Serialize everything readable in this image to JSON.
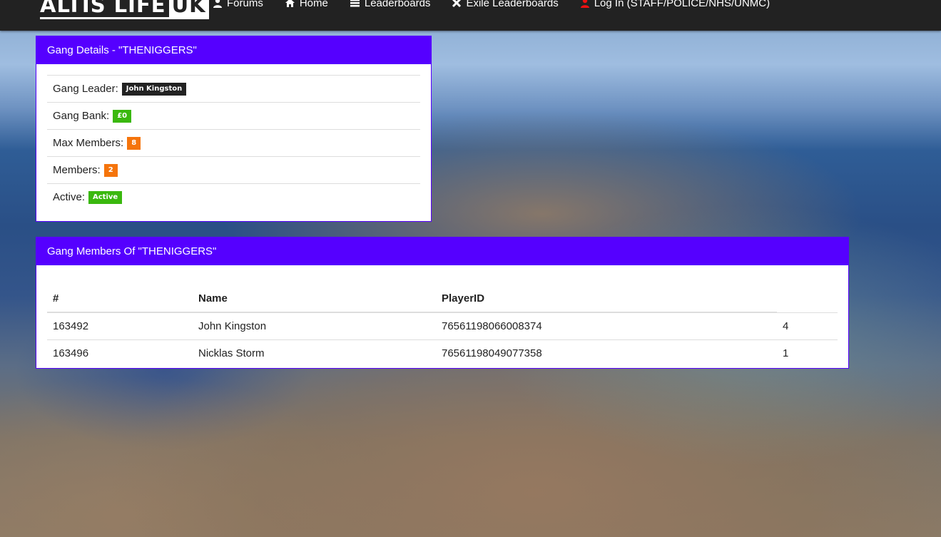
{
  "nav": {
    "brand_main": "ALTIS LIFE",
    "brand_suffix": "UK",
    "links": [
      {
        "label": "Forums",
        "icon": "user-icon"
      },
      {
        "label": "Home",
        "icon": "home-icon"
      },
      {
        "label": "Leaderboards",
        "icon": "list-icon"
      },
      {
        "label": "Exile Leaderboards",
        "icon": "cross-icon"
      },
      {
        "label": "Log In (STAFF/POLICE/NHS/UNMC)",
        "icon": "user-icon"
      }
    ]
  },
  "details": {
    "heading": "Gang Details - \"THENIGGERS\"",
    "rows": [
      {
        "label": "Gang Leader:",
        "value": "John Kingston"
      },
      {
        "label": "Gang Bank:",
        "value": "£0"
      },
      {
        "label": "Max Members:",
        "value": "8"
      },
      {
        "label": "Members:",
        "value": "2"
      },
      {
        "label": "Active:",
        "value": "Active"
      }
    ]
  },
  "members": {
    "heading": "Gang Members Of \"THENIGGERS\"",
    "columns": [
      "#",
      "Name",
      "PlayerID",
      ""
    ],
    "rows": [
      [
        "163492",
        "John Kingston",
        "76561198066008374",
        "4"
      ],
      [
        "163496",
        "Nicklas Storm",
        "76561198049077358",
        "1"
      ]
    ]
  },
  "colors": {
    "accent": "#5500ff",
    "navbar": "#222222",
    "badge_green": "#3ab80e",
    "badge_orange": "#f5740b"
  }
}
